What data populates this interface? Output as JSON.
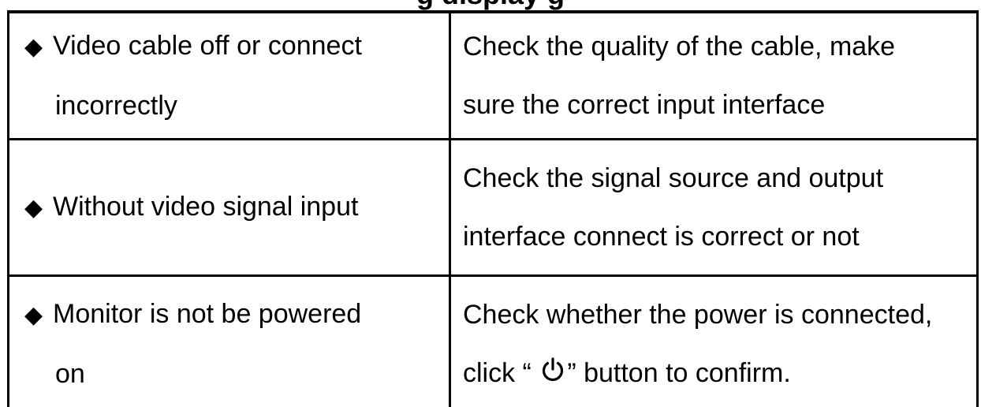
{
  "heading": "g display                                          g",
  "rows": [
    {
      "bullet": "◆",
      "cause_line_1": "Video cable off or connect",
      "cause_line_2": "incorrectly",
      "solution_line_1": "Check the quality of the cable, make",
      "solution_line_2": "sure the correct input interface"
    },
    {
      "bullet": "◆",
      "cause_line_1": "Without video signal input",
      "solution_line_1": "Check the signal source and output",
      "solution_line_2": "interface connect is correct or not"
    },
    {
      "bullet": "◆",
      "cause_line_1": "Monitor is not be powered",
      "cause_line_2": "on",
      "solution_line_1": "Check whether the power is connected,",
      "solution_line_2_prefix": "click “ ",
      "power_icon": "power-icon",
      "solution_line_2_suffix": "” button to confirm."
    }
  ]
}
